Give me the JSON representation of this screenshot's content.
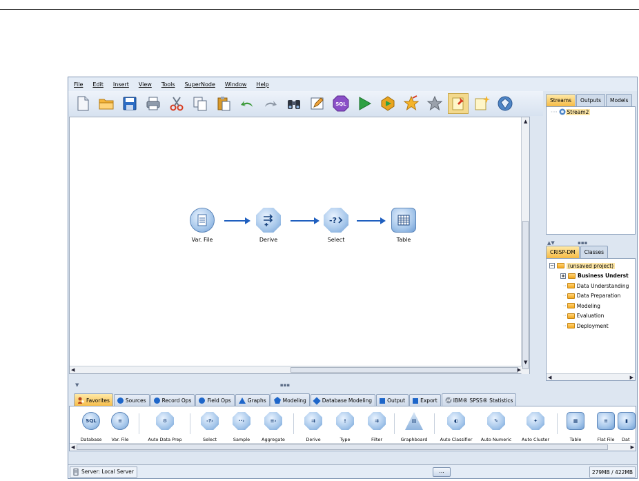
{
  "menubar": {
    "items": [
      "File",
      "Edit",
      "Insert",
      "View",
      "Tools",
      "SuperNode",
      "Window",
      "Help"
    ]
  },
  "toolbar": {
    "buttons": [
      "new-stream",
      "open-stream",
      "save-stream",
      "print",
      "cut",
      "copy",
      "paste",
      "undo",
      "redo",
      "find",
      "edit-annotation",
      "sql-preview",
      "run-stream",
      "run-selection",
      "favorite-add",
      "favorite-remove",
      "insert-annotation",
      "new-comment",
      "model-gem"
    ],
    "sql_label": "SQL"
  },
  "canvas": {
    "nodes": [
      {
        "label": "Var. File",
        "shape": "circle"
      },
      {
        "label": "Derive",
        "shape": "octagon"
      },
      {
        "label": "Select",
        "shape": "octagon"
      },
      {
        "label": "Table",
        "shape": "square"
      }
    ]
  },
  "manager": {
    "tabs": [
      "Streams",
      "Outputs",
      "Models"
    ],
    "active_tab": "Streams",
    "items": [
      "Stream2"
    ]
  },
  "project": {
    "tabs": [
      "CRISP-DM",
      "Classes"
    ],
    "active_tab": "CRISP-DM",
    "root": "(unsaved project)",
    "items": [
      "Business Underst",
      "Data Understanding",
      "Data Preparation",
      "Modeling",
      "Evaluation",
      "Deployment"
    ]
  },
  "palette_tabs": [
    {
      "label": "Favorites",
      "icon": "favorites-icon",
      "active": true
    },
    {
      "label": "Sources",
      "icon": "dot"
    },
    {
      "label": "Record Ops",
      "icon": "dot"
    },
    {
      "label": "Field Ops",
      "icon": "dot"
    },
    {
      "label": "Graphs",
      "icon": "triangle"
    },
    {
      "label": "Modeling",
      "icon": "pentagon"
    },
    {
      "label": "Database Modeling",
      "icon": "diamond"
    },
    {
      "label": "Output",
      "icon": "square"
    },
    {
      "label": "Export",
      "icon": "square"
    },
    {
      "label": "IBM® SPSS® Statistics",
      "icon": "spss-icon"
    }
  ],
  "palette_nodes": [
    {
      "label": "Database",
      "glyph": "SQL"
    },
    {
      "label": "Var. File",
      "glyph": "≡"
    },
    {
      "label": "Auto Data Prep",
      "glyph": "⚙"
    },
    {
      "label": "Select",
      "glyph": "-?›"
    },
    {
      "label": "Sample",
      "glyph": "··›"
    },
    {
      "label": "Aggregate",
      "glyph": "≡›"
    },
    {
      "label": "Derive",
      "glyph": "⇉"
    },
    {
      "label": "Type",
      "glyph": "⋮"
    },
    {
      "label": "Filter",
      "glyph": "⇉"
    },
    {
      "label": "Graphboard",
      "glyph": "▤"
    },
    {
      "label": "Auto Classifier",
      "glyph": "◐"
    },
    {
      "label": "Auto Numeric",
      "glyph": "✎"
    },
    {
      "label": "Auto Cluster",
      "glyph": "✦"
    },
    {
      "label": "Table",
      "glyph": "▦"
    },
    {
      "label": "Flat File",
      "glyph": "≡"
    },
    {
      "label": "Dat",
      "glyph": "▮"
    }
  ],
  "status": {
    "server": "Server: Local Server",
    "center": "...",
    "memory": "279MB / 422MB"
  },
  "colors": {
    "accent_tab": "#f6bb45",
    "link_arrow": "#1f5fbf",
    "node_fill": "#a5c6ea"
  }
}
